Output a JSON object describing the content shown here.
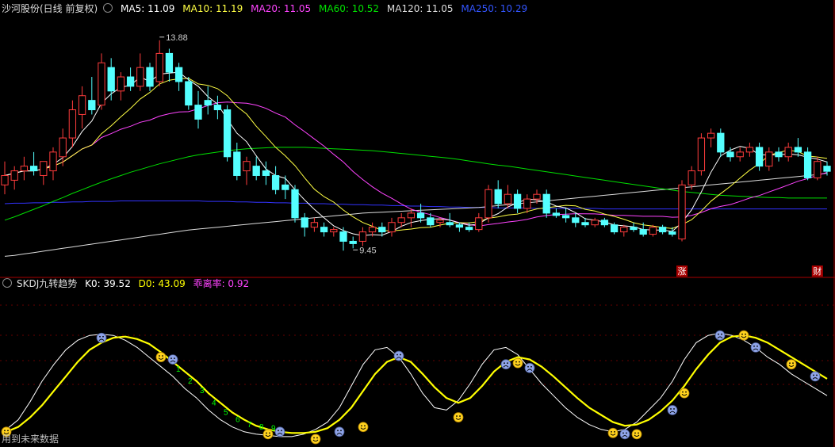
{
  "main_legend": {
    "title": "沙河股份(日线 前复权)",
    "ma5": "MA5: 11.09",
    "ma10": "MA10: 11.19",
    "ma20": "MA20: 11.05",
    "ma60": "MA60: 10.52",
    "ma120": "MA120: 11.05",
    "ma250": "MA250: 10.29"
  },
  "sub_legend": {
    "title": "SKDJ九转趋势",
    "k": "K0: 39.52",
    "d": "D0: 43.09",
    "dev": "乖离率: 0.92"
  },
  "footer_note": "用到未来数据",
  "colors": {
    "up": "#ff3c3c",
    "down": "#54ffff",
    "ma5": "#ffffff",
    "ma10": "#ffff44",
    "ma20": "#ff44ff",
    "ma60": "#00e000",
    "ma120": "#dddddd",
    "ma250": "#3333ff",
    "k": "#ffffff",
    "d": "#ffff00",
    "seq": "#00ff00"
  },
  "chart_data": [
    {
      "type": "candlestick",
      "price_range": [
        9.0,
        14.4
      ],
      "annotations": [
        {
          "text": "13.88",
          "index": 16,
          "price": 13.88,
          "kind": "high"
        },
        {
          "text": "9.45",
          "index": 36,
          "price": 9.45,
          "kind": "low"
        }
      ],
      "markers": [
        {
          "text": "涨",
          "index": 70
        },
        {
          "text": "财",
          "index": 84
        }
      ],
      "candles": [
        {
          "o": 10.8,
          "h": 11.3,
          "l": 10.6,
          "c": 11.0
        },
        {
          "o": 10.9,
          "h": 11.2,
          "l": 10.7,
          "c": 11.1
        },
        {
          "o": 11.1,
          "h": 11.4,
          "l": 10.9,
          "c": 11.2
        },
        {
          "o": 11.2,
          "h": 11.5,
          "l": 11.0,
          "c": 11.1
        },
        {
          "o": 11.0,
          "h": 11.3,
          "l": 10.8,
          "c": 11.3
        },
        {
          "o": 11.1,
          "h": 11.6,
          "l": 10.9,
          "c": 11.5
        },
        {
          "o": 11.4,
          "h": 12.0,
          "l": 11.2,
          "c": 11.8
        },
        {
          "o": 11.8,
          "h": 12.6,
          "l": 11.6,
          "c": 12.4
        },
        {
          "o": 12.3,
          "h": 12.9,
          "l": 12.0,
          "c": 12.7
        },
        {
          "o": 12.6,
          "h": 13.1,
          "l": 12.3,
          "c": 12.4
        },
        {
          "o": 12.5,
          "h": 13.6,
          "l": 12.4,
          "c": 13.4
        },
        {
          "o": 13.3,
          "h": 13.5,
          "l": 12.6,
          "c": 12.8
        },
        {
          "o": 12.8,
          "h": 13.2,
          "l": 12.6,
          "c": 13.1
        },
        {
          "o": 13.1,
          "h": 13.3,
          "l": 12.8,
          "c": 12.9
        },
        {
          "o": 12.9,
          "h": 13.6,
          "l": 12.8,
          "c": 13.3
        },
        {
          "o": 13.3,
          "h": 13.4,
          "l": 12.8,
          "c": 12.9
        },
        {
          "o": 13.0,
          "h": 13.88,
          "l": 12.9,
          "c": 13.6
        },
        {
          "o": 13.6,
          "h": 13.7,
          "l": 13.0,
          "c": 13.2
        },
        {
          "o": 13.3,
          "h": 13.4,
          "l": 12.8,
          "c": 13.0
        },
        {
          "o": 13.0,
          "h": 13.1,
          "l": 12.4,
          "c": 12.5
        },
        {
          "o": 12.5,
          "h": 12.8,
          "l": 12.0,
          "c": 12.2
        },
        {
          "o": 12.6,
          "h": 12.9,
          "l": 12.3,
          "c": 12.5
        },
        {
          "o": 12.5,
          "h": 12.7,
          "l": 12.2,
          "c": 12.4
        },
        {
          "o": 12.4,
          "h": 12.5,
          "l": 11.3,
          "c": 11.4
        },
        {
          "o": 11.5,
          "h": 11.7,
          "l": 10.9,
          "c": 11.0
        },
        {
          "o": 11.1,
          "h": 11.4,
          "l": 10.8,
          "c": 11.3
        },
        {
          "o": 11.2,
          "h": 11.4,
          "l": 10.9,
          "c": 11.0
        },
        {
          "o": 11.1,
          "h": 11.3,
          "l": 10.8,
          "c": 11.0
        },
        {
          "o": 11.0,
          "h": 11.2,
          "l": 10.6,
          "c": 10.7
        },
        {
          "o": 10.8,
          "h": 11.0,
          "l": 10.5,
          "c": 10.7
        },
        {
          "o": 10.7,
          "h": 10.8,
          "l": 10.0,
          "c": 10.1
        },
        {
          "o": 10.1,
          "h": 10.2,
          "l": 9.7,
          "c": 9.9
        },
        {
          "o": 9.9,
          "h": 10.1,
          "l": 9.8,
          "c": 10.0
        },
        {
          "o": 9.9,
          "h": 10.0,
          "l": 9.7,
          "c": 9.8
        },
        {
          "o": 9.8,
          "h": 9.9,
          "l": 9.7,
          "c": 9.85
        },
        {
          "o": 9.8,
          "h": 9.9,
          "l": 9.4,
          "c": 9.6
        },
        {
          "o": 9.6,
          "h": 9.7,
          "l": 9.45,
          "c": 9.55
        },
        {
          "o": 9.6,
          "h": 9.9,
          "l": 9.5,
          "c": 9.8
        },
        {
          "o": 9.8,
          "h": 10.0,
          "l": 9.7,
          "c": 9.9
        },
        {
          "o": 9.9,
          "h": 10.0,
          "l": 9.7,
          "c": 9.8
        },
        {
          "o": 9.8,
          "h": 10.1,
          "l": 9.7,
          "c": 10.0
        },
        {
          "o": 10.0,
          "h": 10.2,
          "l": 9.9,
          "c": 10.1
        },
        {
          "o": 10.1,
          "h": 10.3,
          "l": 9.9,
          "c": 10.2
        },
        {
          "o": 10.2,
          "h": 10.4,
          "l": 10.0,
          "c": 10.1
        },
        {
          "o": 10.1,
          "h": 10.2,
          "l": 9.9,
          "c": 9.95
        },
        {
          "o": 10.0,
          "h": 10.1,
          "l": 9.9,
          "c": 10.05
        },
        {
          "o": 10.0,
          "h": 10.2,
          "l": 9.9,
          "c": 9.95
        },
        {
          "o": 9.95,
          "h": 10.0,
          "l": 9.8,
          "c": 9.9
        },
        {
          "o": 9.9,
          "h": 10.0,
          "l": 9.8,
          "c": 9.85
        },
        {
          "o": 9.85,
          "h": 10.2,
          "l": 9.8,
          "c": 10.1
        },
        {
          "o": 10.1,
          "h": 10.8,
          "l": 10.0,
          "c": 10.7
        },
        {
          "o": 10.7,
          "h": 10.9,
          "l": 10.3,
          "c": 10.4
        },
        {
          "o": 10.4,
          "h": 10.8,
          "l": 10.3,
          "c": 10.6
        },
        {
          "o": 10.6,
          "h": 10.7,
          "l": 10.2,
          "c": 10.3
        },
        {
          "o": 10.3,
          "h": 10.6,
          "l": 10.2,
          "c": 10.5
        },
        {
          "o": 10.5,
          "h": 10.7,
          "l": 10.4,
          "c": 10.6
        },
        {
          "o": 10.6,
          "h": 10.7,
          "l": 10.1,
          "c": 10.2
        },
        {
          "o": 10.2,
          "h": 10.3,
          "l": 10.1,
          "c": 10.15
        },
        {
          "o": 10.15,
          "h": 10.3,
          "l": 10.0,
          "c": 10.1
        },
        {
          "o": 10.1,
          "h": 10.2,
          "l": 9.9,
          "c": 10.0
        },
        {
          "o": 10.0,
          "h": 10.1,
          "l": 9.9,
          "c": 9.95
        },
        {
          "o": 9.95,
          "h": 10.1,
          "l": 9.9,
          "c": 10.05
        },
        {
          "o": 10.05,
          "h": 10.1,
          "l": 9.9,
          "c": 9.95
        },
        {
          "o": 9.95,
          "h": 10.0,
          "l": 9.75,
          "c": 9.8
        },
        {
          "o": 9.8,
          "h": 9.95,
          "l": 9.7,
          "c": 9.9
        },
        {
          "o": 9.9,
          "h": 10.0,
          "l": 9.8,
          "c": 9.85
        },
        {
          "o": 9.85,
          "h": 10.0,
          "l": 9.7,
          "c": 9.75
        },
        {
          "o": 9.75,
          "h": 9.95,
          "l": 9.7,
          "c": 9.9
        },
        {
          "o": 9.9,
          "h": 9.95,
          "l": 9.75,
          "c": 9.8
        },
        {
          "o": 9.8,
          "h": 9.9,
          "l": 9.7,
          "c": 9.75
        },
        {
          "o": 9.65,
          "h": 10.9,
          "l": 9.6,
          "c": 10.8
        },
        {
          "o": 10.8,
          "h": 11.2,
          "l": 10.7,
          "c": 11.1
        },
        {
          "o": 11.1,
          "h": 11.9,
          "l": 11.0,
          "c": 11.8
        },
        {
          "o": 11.8,
          "h": 12.0,
          "l": 11.6,
          "c": 11.9
        },
        {
          "o": 11.9,
          "h": 12.0,
          "l": 11.4,
          "c": 11.5
        },
        {
          "o": 11.5,
          "h": 11.6,
          "l": 11.3,
          "c": 11.4
        },
        {
          "o": 11.4,
          "h": 11.6,
          "l": 11.3,
          "c": 11.5
        },
        {
          "o": 11.5,
          "h": 11.7,
          "l": 11.4,
          "c": 11.6
        },
        {
          "o": 11.6,
          "h": 11.7,
          "l": 11.1,
          "c": 11.2
        },
        {
          "o": 11.2,
          "h": 11.6,
          "l": 11.1,
          "c": 11.5
        },
        {
          "o": 11.5,
          "h": 11.6,
          "l": 11.3,
          "c": 11.4
        },
        {
          "o": 11.4,
          "h": 11.7,
          "l": 11.3,
          "c": 11.6
        },
        {
          "o": 11.6,
          "h": 11.8,
          "l": 11.4,
          "c": 11.5
        },
        {
          "o": 11.5,
          "h": 11.6,
          "l": 10.9,
          "c": 10.95
        },
        {
          "o": 10.95,
          "h": 11.4,
          "l": 10.9,
          "c": 11.3
        },
        {
          "o": 11.2,
          "h": 11.3,
          "l": 11.0,
          "c": 11.09
        }
      ],
      "ma60": [
        10.05,
        10.12,
        10.2,
        10.28,
        10.36,
        10.45,
        10.53,
        10.62,
        10.7,
        10.78,
        10.86,
        10.93,
        11.0,
        11.07,
        11.13,
        11.19,
        11.25,
        11.3,
        11.35,
        11.4,
        11.44,
        11.47,
        11.5,
        11.53,
        11.55,
        11.57,
        11.58,
        11.59,
        11.6,
        11.6,
        11.6,
        11.6,
        11.59,
        11.58,
        11.57,
        11.56,
        11.55,
        11.54,
        11.53,
        11.51,
        11.49,
        11.47,
        11.45,
        11.43,
        11.41,
        11.39,
        11.37,
        11.34,
        11.31,
        11.28,
        11.25,
        11.22,
        11.2,
        11.17,
        11.14,
        11.11,
        11.08,
        11.05,
        11.02,
        10.99,
        10.96,
        10.93,
        10.9,
        10.87,
        10.84,
        10.81,
        10.78,
        10.75,
        10.72,
        10.69,
        10.66,
        10.64,
        10.62,
        10.6,
        10.58,
        10.57,
        10.56,
        10.55,
        10.54,
        10.53,
        10.53,
        10.52,
        10.52,
        10.52,
        10.52,
        10.52
      ],
      "ma120": [
        9.28,
        9.3,
        9.33,
        9.36,
        9.39,
        9.42,
        9.45,
        9.48,
        9.51,
        9.54,
        9.57,
        9.6,
        9.63,
        9.66,
        9.69,
        9.72,
        9.75,
        9.78,
        9.81,
        9.84,
        9.86,
        9.88,
        9.9,
        9.92,
        9.94,
        9.96,
        9.98,
        10.0,
        10.02,
        10.04,
        10.06,
        10.08,
        10.1,
        10.12,
        10.14,
        10.16,
        10.18,
        10.2,
        10.21,
        10.22,
        10.23,
        10.24,
        10.25,
        10.26,
        10.27,
        10.28,
        10.29,
        10.3,
        10.31,
        10.32,
        10.34,
        10.36,
        10.38,
        10.4,
        10.42,
        10.44,
        10.46,
        10.48,
        10.5,
        10.52,
        10.54,
        10.56,
        10.58,
        10.6,
        10.62,
        10.64,
        10.66,
        10.68,
        10.7,
        10.72,
        10.74,
        10.76,
        10.78,
        10.8,
        10.82,
        10.84,
        10.86,
        10.88,
        10.9,
        10.92,
        10.94,
        10.96,
        10.98,
        11.0,
        11.02,
        11.05
      ],
      "ma250": [
        10.4,
        10.41,
        10.41,
        10.42,
        10.42,
        10.43,
        10.43,
        10.44,
        10.44,
        10.45,
        10.45,
        10.45,
        10.46,
        10.46,
        10.46,
        10.46,
        10.46,
        10.46,
        10.46,
        10.46,
        10.46,
        10.45,
        10.45,
        10.45,
        10.44,
        10.44,
        10.43,
        10.43,
        10.42,
        10.42,
        10.41,
        10.41,
        10.4,
        10.4,
        10.39,
        10.39,
        10.38,
        10.38,
        10.37,
        10.37,
        10.36,
        10.36,
        10.35,
        10.35,
        10.34,
        10.34,
        10.33,
        10.33,
        10.32,
        10.32,
        10.32,
        10.31,
        10.31,
        10.31,
        10.31,
        10.3,
        10.3,
        10.3,
        10.3,
        10.3,
        10.3,
        10.3,
        10.29,
        10.29,
        10.29,
        10.29,
        10.29,
        10.29,
        10.29,
        10.29,
        10.29,
        10.29,
        10.29,
        10.29,
        10.29,
        10.29,
        10.29,
        10.29,
        10.29,
        10.29,
        10.29,
        10.29,
        10.29,
        10.29,
        10.29,
        10.29
      ]
    },
    {
      "type": "line",
      "indicator": "SKDJ",
      "y_range": [
        0,
        100
      ],
      "K": [
        12,
        20,
        35,
        52,
        66,
        78,
        86,
        90,
        91,
        90,
        86,
        80,
        72,
        64,
        56,
        46,
        38,
        28,
        20,
        14,
        10,
        8,
        7,
        6,
        6,
        8,
        12,
        18,
        30,
        48,
        66,
        78,
        80,
        72,
        58,
        42,
        30,
        28,
        36,
        50,
        66,
        78,
        80,
        74,
        62,
        50,
        40,
        30,
        22,
        16,
        12,
        10,
        12,
        18,
        28,
        38,
        52,
        70,
        84,
        90,
        92,
        90,
        86,
        80,
        72,
        66,
        58,
        52,
        46,
        40
      ],
      "D": [
        10,
        14,
        22,
        32,
        44,
        56,
        68,
        78,
        84,
        88,
        89,
        87,
        83,
        76,
        68,
        60,
        52,
        42,
        34,
        26,
        20,
        15,
        12,
        10,
        9,
        9,
        10,
        13,
        20,
        30,
        44,
        58,
        68,
        72,
        68,
        58,
        47,
        38,
        34,
        38,
        48,
        60,
        68,
        72,
        70,
        64,
        56,
        47,
        38,
        30,
        24,
        18,
        15,
        16,
        20,
        27,
        36,
        48,
        62,
        74,
        84,
        89,
        90,
        88,
        84,
        78,
        72,
        66,
        60,
        54
      ],
      "sequence_digits": [
        "1",
        "2",
        "3",
        "4",
        "5",
        "6",
        "7",
        "8",
        "9"
      ],
      "signals": [
        {
          "index": 0,
          "face": "smile",
          "value": 10
        },
        {
          "index": 8,
          "face": "sad",
          "value": 88
        },
        {
          "index": 13,
          "face": "smile",
          "value": 72
        },
        {
          "index": 14,
          "face": "sad",
          "value": 70
        },
        {
          "index": 22,
          "face": "smile",
          "value": 8
        },
        {
          "index": 23,
          "face": "sad",
          "value": 10
        },
        {
          "index": 26,
          "face": "smile",
          "value": 4
        },
        {
          "index": 28,
          "face": "sad",
          "value": 10
        },
        {
          "index": 30,
          "face": "smile",
          "value": 14
        },
        {
          "index": 33,
          "face": "sad",
          "value": 73
        },
        {
          "index": 38,
          "face": "smile",
          "value": 22
        },
        {
          "index": 42,
          "face": "sad",
          "value": 66
        },
        {
          "index": 43,
          "face": "smile",
          "value": 67
        },
        {
          "index": 44,
          "face": "sad",
          "value": 63
        },
        {
          "index": 51,
          "face": "smile",
          "value": 9
        },
        {
          "index": 52,
          "face": "sad",
          "value": 8
        },
        {
          "index": 53,
          "face": "smile",
          "value": 8
        },
        {
          "index": 56,
          "face": "sad",
          "value": 28
        },
        {
          "index": 57,
          "face": "smile",
          "value": 42
        },
        {
          "index": 60,
          "face": "sad",
          "value": 90
        },
        {
          "index": 62,
          "face": "smile",
          "value": 90
        },
        {
          "index": 63,
          "face": "sad",
          "value": 80
        },
        {
          "index": 66,
          "face": "smile",
          "value": 66
        },
        {
          "index": 68,
          "face": "sad",
          "value": 56
        }
      ]
    }
  ]
}
